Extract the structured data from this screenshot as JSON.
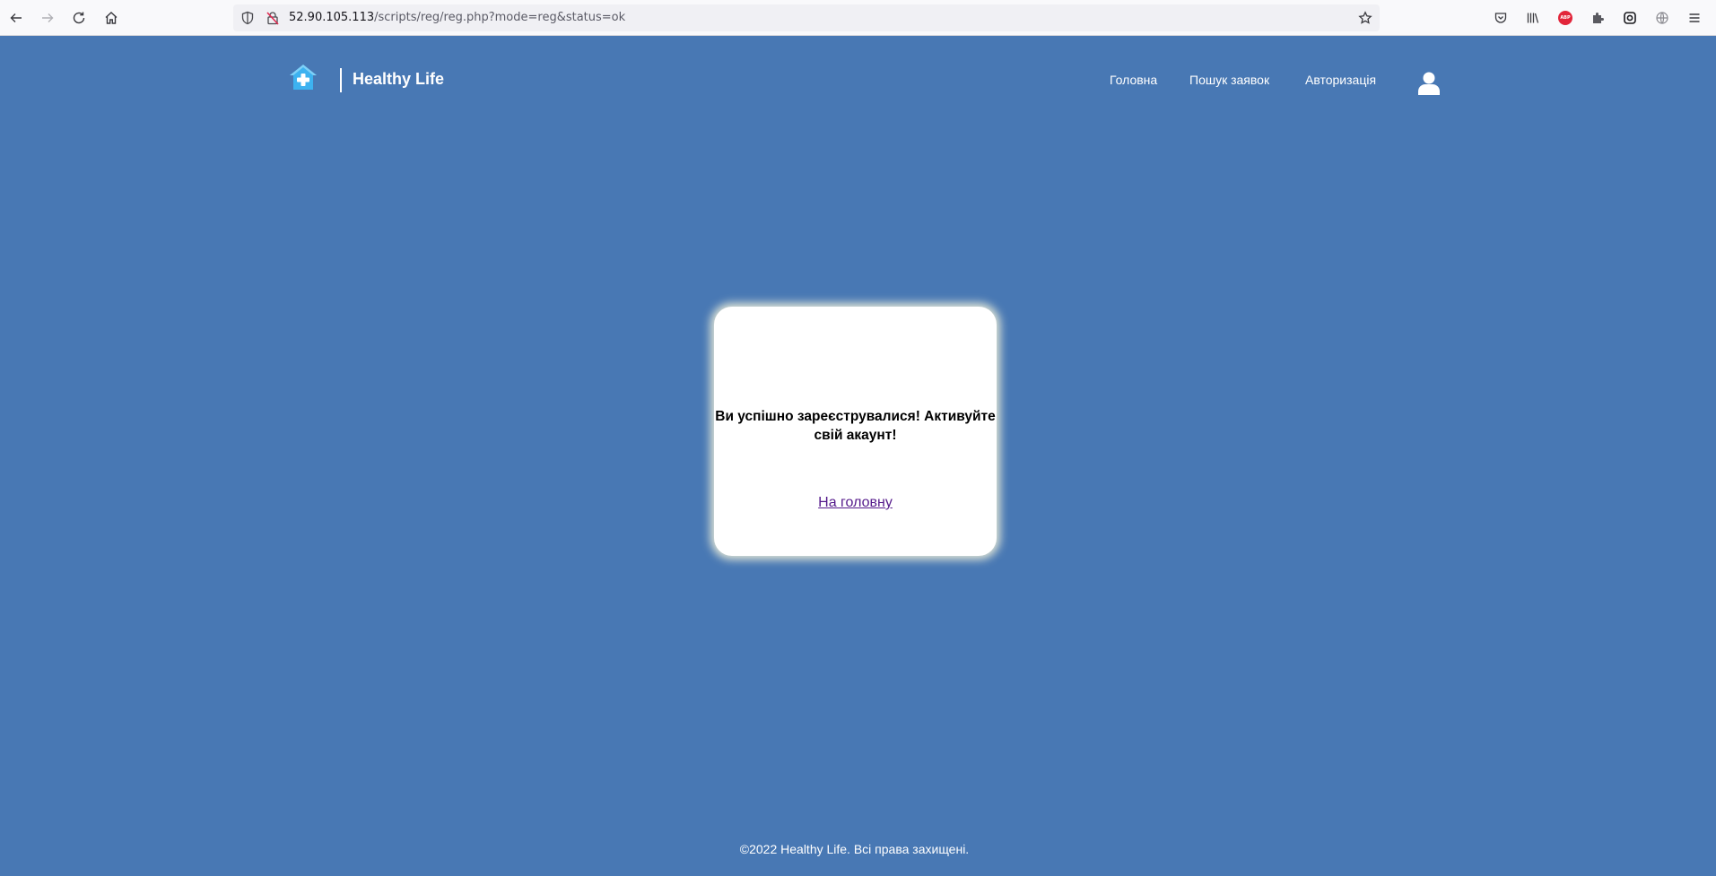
{
  "browser": {
    "url_host": "52.90.105.113",
    "url_path": "/scripts/reg/reg.php?mode=reg&status=ok",
    "abp_label": "ABP"
  },
  "header": {
    "brand_name": "Healthy Life",
    "nav": [
      {
        "label": "Головна"
      },
      {
        "label": "Пошук заявок"
      },
      {
        "label": "Авторизація"
      }
    ]
  },
  "card": {
    "message": "Ви успішно зареєструвалися! Активуйте свій акаунт!",
    "link_label": "На головну"
  },
  "footer": {
    "copyright": "©2022 Healthy Life. Всі права захищені."
  },
  "colors": {
    "page_background": "#4878b4",
    "logo_accent": "#3db2f0",
    "link_visited": "#551a8b"
  }
}
